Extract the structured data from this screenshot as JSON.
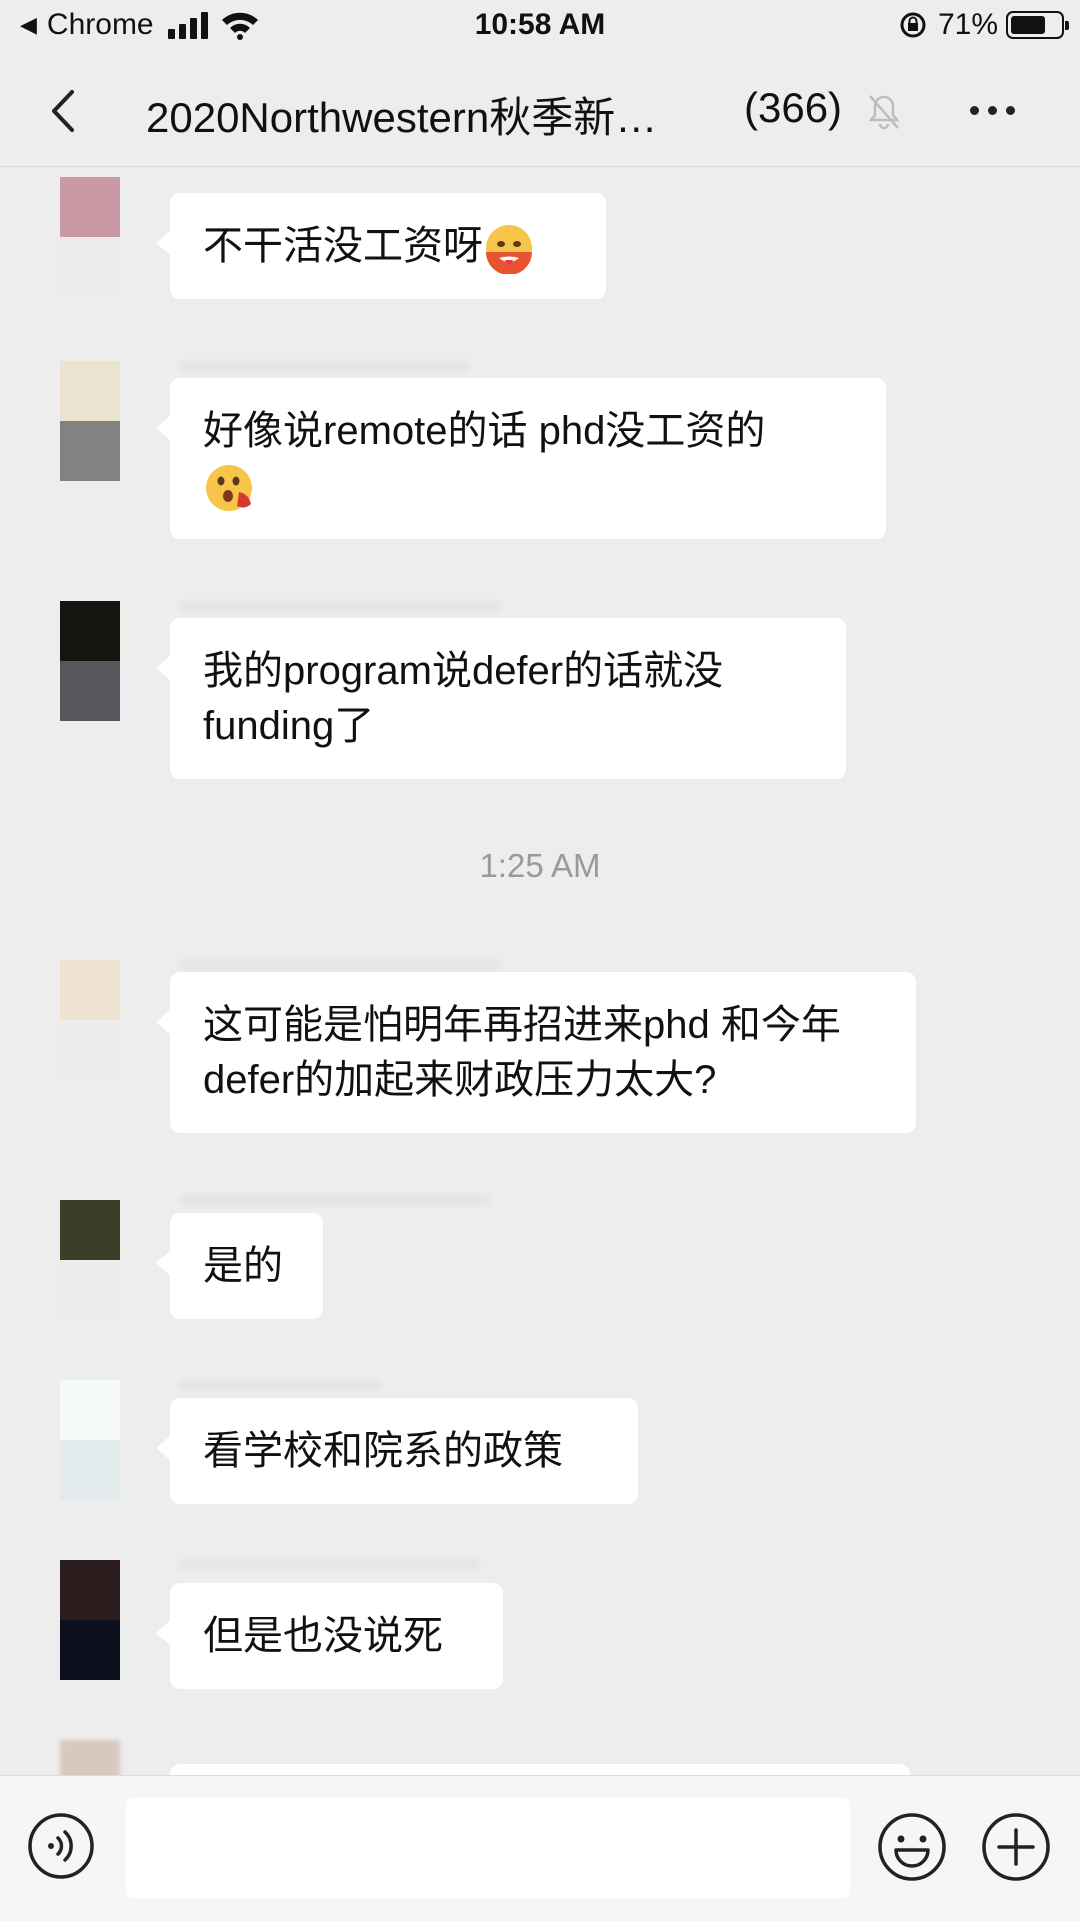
{
  "status_bar": {
    "back_app": "Chrome",
    "time": "10:58 AM",
    "battery_percent": "71%",
    "battery_level": 0.71
  },
  "navbar": {
    "title": "2020Northwestern秋季新…",
    "member_count": "(366)"
  },
  "messages": [
    {
      "text": "不干活没工资呀",
      "emoji": "hot-face-emoji",
      "avatar_colors": [
        "#c99aa5",
        "#ececec"
      ]
    },
    {
      "text": "好像说remote的话 phd没工资的",
      "emoji": "astonished-hand-emoji",
      "avatar_colors": [
        "#ebe3d0",
        "#828282"
      ]
    },
    {
      "text": "我的program说defer的话就没funding了",
      "avatar_colors": [
        "#151510",
        "#56575d"
      ]
    },
    {
      "text": "这可能是怕明年再招进来phd 和今年defer的加起来财政压力太大?",
      "avatar_colors": [
        "#ede3d0",
        "#ececec"
      ]
    },
    {
      "text": "是的",
      "avatar_colors": [
        "#3a4028",
        "#ececec"
      ]
    },
    {
      "text": "看学校和院系的政策",
      "avatar_colors": [
        "#f6faf7",
        "#e2eaec"
      ]
    },
    {
      "text": "但是也没说死",
      "avatar_colors": [
        "#2b1c1d",
        "#0c101c"
      ]
    }
  ],
  "time_separator": "1:25 AM",
  "input": {
    "placeholder": ""
  },
  "colors": {
    "background": "#ededed",
    "bubble": "#ffffff",
    "timestamp": "#9a9a9a"
  }
}
